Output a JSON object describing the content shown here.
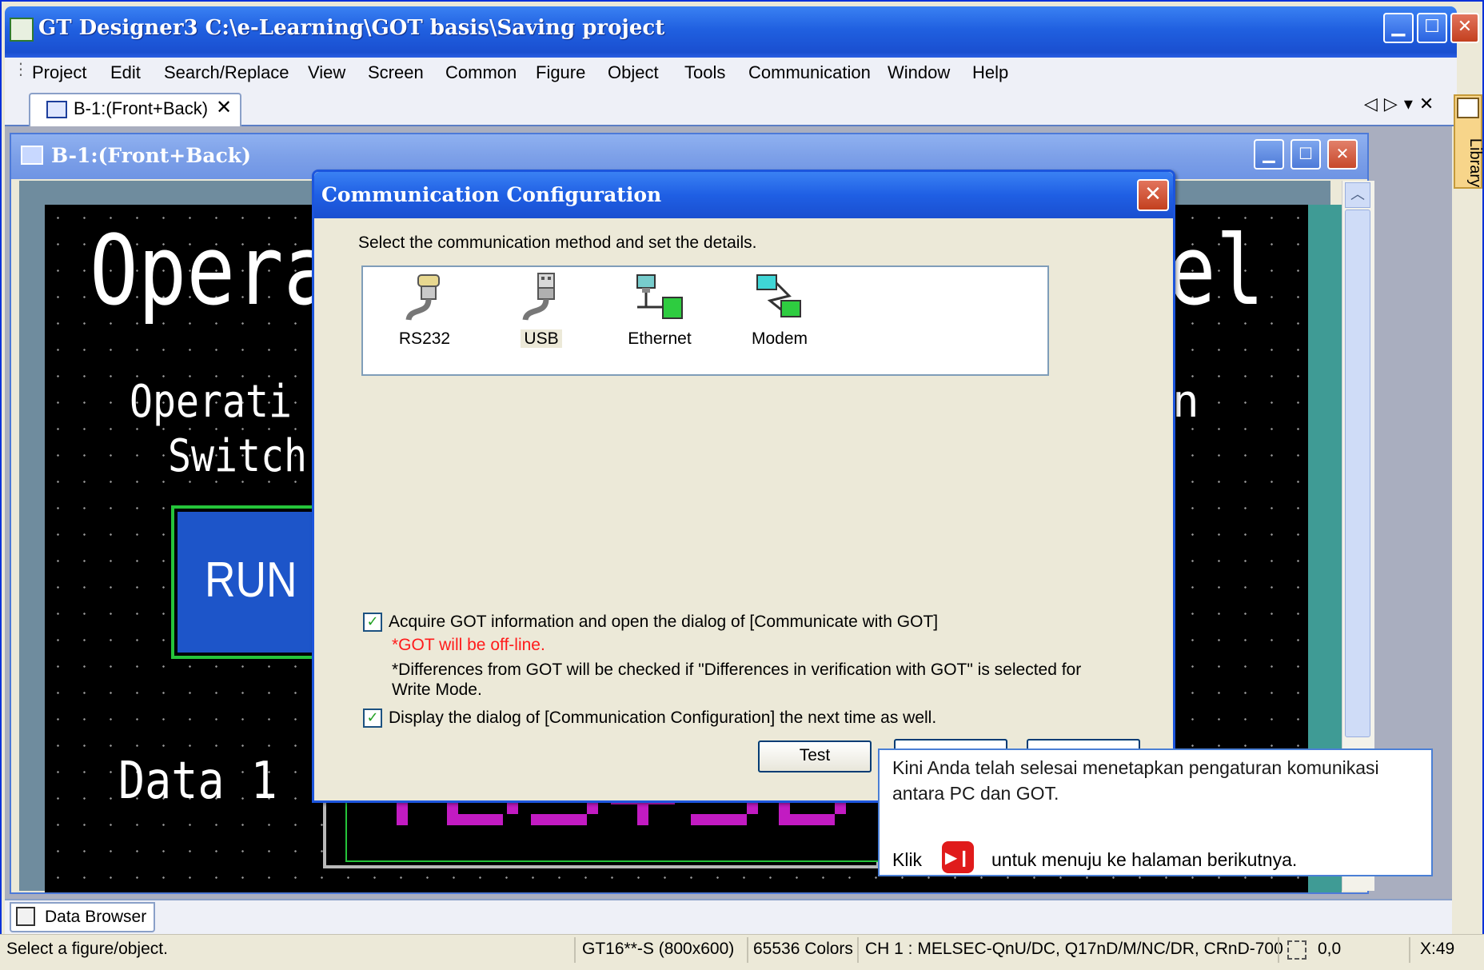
{
  "app": {
    "title": "GT Designer3 C:\\e-Learning\\GOT basis\\Saving project"
  },
  "menu": [
    "Project",
    "Edit",
    "Search/Replace",
    "View",
    "Screen",
    "Common",
    "Figure",
    "Object",
    "Tools",
    "Communication",
    "Window",
    "Help"
  ],
  "tabs": {
    "active": "B-1:(Front+Back)",
    "close": "✕",
    "nav": "◁▷▾✕"
  },
  "library": {
    "label": "Library"
  },
  "child_window": {
    "title": "B-1:(Front+Back)"
  },
  "screen_preview": {
    "title_left": "Opera",
    "title_right": "el",
    "sub1": "Operati",
    "sub2": "Switch",
    "sub_right": "n",
    "run_label": "RUN",
    "data_label": "Data 1"
  },
  "dialog": {
    "title": "Communication Configuration",
    "instruction": "Select the communication method and set the details.",
    "methods": [
      {
        "label": "RS232",
        "icon": "serial-cable-icon"
      },
      {
        "label": "USB",
        "icon": "usb-cable-icon"
      },
      {
        "label": "Ethernet",
        "icon": "ethernet-network-icon"
      },
      {
        "label": "Modem",
        "icon": "modem-icon"
      }
    ],
    "selected_method": "USB",
    "option1": {
      "label": "Acquire GOT information and open the dialog of [Communicate with GOT]",
      "checked": true,
      "warning": "*GOT will be off-line.",
      "note": "*Differences from GOT will be checked if \"Differences in verification with GOT\" is selected for Write Mode."
    },
    "option2": {
      "label": "Display the dialog of [Communication Configuration] the next time as well.",
      "checked": true
    },
    "test_button": "Test"
  },
  "tooltip": {
    "message": "Kini Anda telah selesai menetapkan pengaturan komunikasi antara PC dan GOT.",
    "klik": "Klik",
    "rest": "untuk menuju ke halaman berikutnya.",
    "accent": "#e01b1b"
  },
  "bottom": {
    "data_browser": "Data Browser"
  },
  "status": {
    "message": "Select a figure/object.",
    "model": "GT16**-S (800x600)",
    "colors": "65536 Colors",
    "channel": "CH 1 : MELSEC-QnU/DC, Q17nD/M/NC/DR, CRnD-700",
    "coords": "0,0",
    "x": "X:49"
  },
  "colors": {
    "titlebar": "#2060e0",
    "canvas": "#000000",
    "run_button": "#1d55c9",
    "numeric_segments": "#c21bc2"
  }
}
